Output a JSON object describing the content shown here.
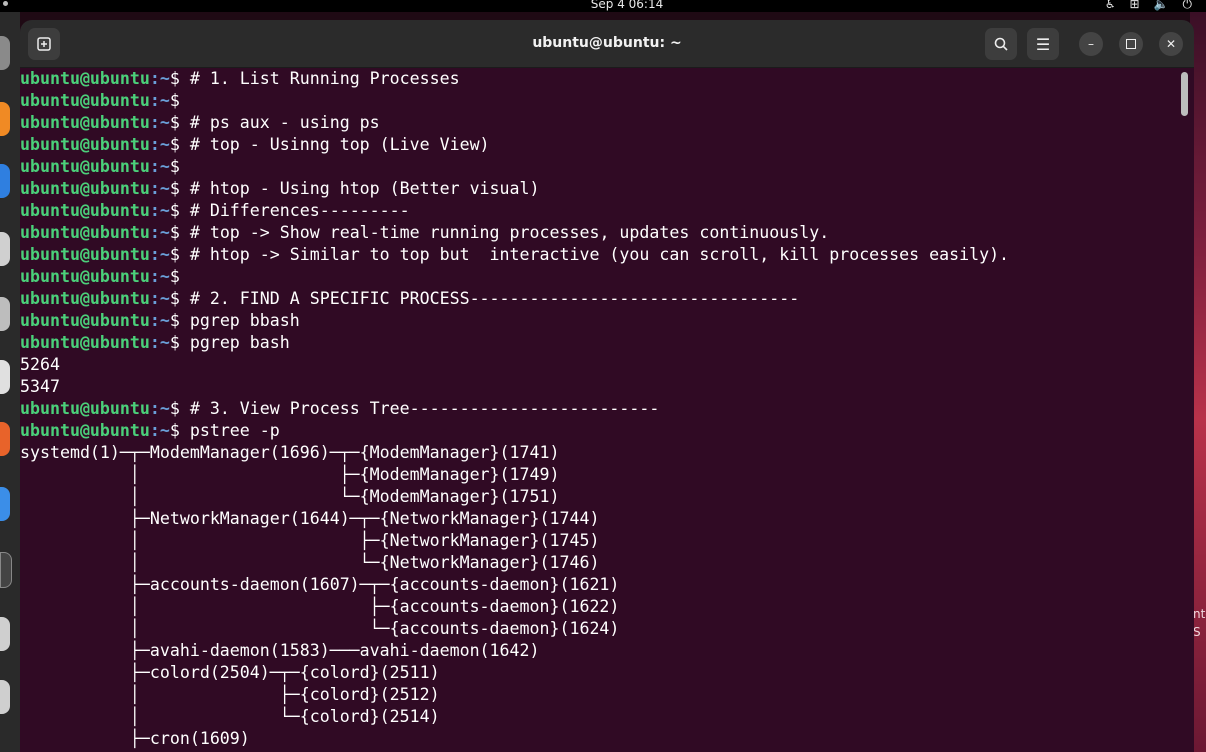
{
  "topbar": {
    "clock": "Sep 4  06:14"
  },
  "window": {
    "title": "ubuntu@ubuntu: ~"
  },
  "prompt": {
    "user_host": "ubuntu@ubuntu",
    "path": ":~",
    "symbol": "$ "
  },
  "terminal_lines": [
    {
      "type": "cmd",
      "text": "# 1. List Running Processes"
    },
    {
      "type": "cmd",
      "text": ""
    },
    {
      "type": "cmd",
      "text": "# ps aux - using ps"
    },
    {
      "type": "cmd",
      "text": "# top - Usinng top (Live View)"
    },
    {
      "type": "cmd",
      "text": ""
    },
    {
      "type": "cmd",
      "text": "# htop - Using htop (Better visual)"
    },
    {
      "type": "cmd",
      "text": "# Differences---------"
    },
    {
      "type": "cmd",
      "text": "# top -> Show real-time running processes, updates continuously."
    },
    {
      "type": "cmd",
      "text": "# htop -> Similar to top but  interactive (you can scroll, kill processes easily)."
    },
    {
      "type": "cmd",
      "text": ""
    },
    {
      "type": "cmd",
      "text": "# 2. FIND A SPECIFIC PROCESS---------------------------------"
    },
    {
      "type": "cmd",
      "text": "pgrep bbash"
    },
    {
      "type": "cmd",
      "text": "pgrep bash"
    },
    {
      "type": "out",
      "text": "5264"
    },
    {
      "type": "out",
      "text": "5347"
    },
    {
      "type": "cmd",
      "text": "# 3. View Process Tree-------------------------"
    },
    {
      "type": "cmd",
      "text": "pstree -p"
    },
    {
      "type": "out",
      "text": "systemd(1)─┬─ModemManager(1696)─┬─{ModemManager}(1741)"
    },
    {
      "type": "out",
      "text": "           │                    ├─{ModemManager}(1749)"
    },
    {
      "type": "out",
      "text": "           │                    └─{ModemManager}(1751)"
    },
    {
      "type": "out",
      "text": "           ├─NetworkManager(1644)─┬─{NetworkManager}(1744)"
    },
    {
      "type": "out",
      "text": "           │                      ├─{NetworkManager}(1745)"
    },
    {
      "type": "out",
      "text": "           │                      └─{NetworkManager}(1746)"
    },
    {
      "type": "out",
      "text": "           ├─accounts-daemon(1607)─┬─{accounts-daemon}(1621)"
    },
    {
      "type": "out",
      "text": "           │                       ├─{accounts-daemon}(1622)"
    },
    {
      "type": "out",
      "text": "           │                       └─{accounts-daemon}(1624)"
    },
    {
      "type": "out",
      "text": "           ├─avahi-daemon(1583)───avahi-daemon(1642)"
    },
    {
      "type": "out",
      "text": "           ├─colord(2504)─┬─{colord}(2511)"
    },
    {
      "type": "out",
      "text": "           │              ├─{colord}(2512)"
    },
    {
      "type": "out",
      "text": "           │              └─{colord}(2514)"
    },
    {
      "type": "out",
      "text": "           ├─cron(1609)"
    }
  ],
  "desktop_fragments": [
    "nte",
    "S"
  ],
  "colors": {
    "terminal_bg": "#300a24",
    "prompt_user": "#4bd07a",
    "prompt_path": "#6a9fd8",
    "headerbar_bg": "#2b2b2b"
  }
}
